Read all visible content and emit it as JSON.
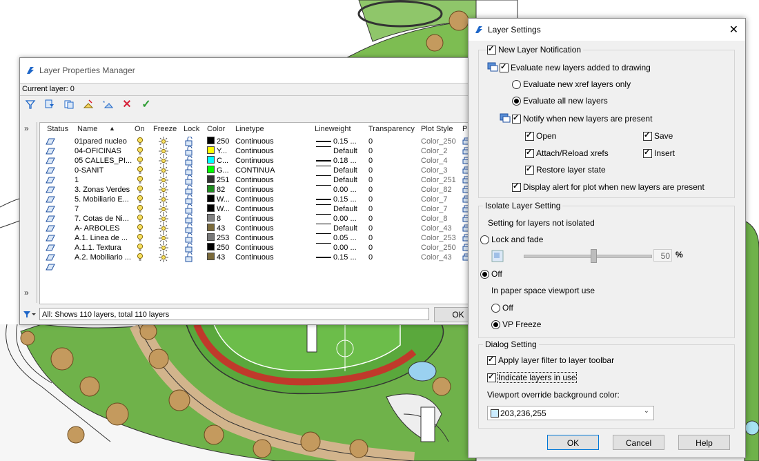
{
  "lpm": {
    "title": "Layer Properties Manager",
    "current_layer": "Current layer: 0",
    "columns": [
      "Status",
      "Name",
      "On",
      "Freeze",
      "Lock",
      "Color",
      "Linetype",
      "Lineweight",
      "Transparency",
      "Plot Style",
      "Pl"
    ],
    "rows": [
      {
        "name": "01pared nucleo",
        "color": "#000000",
        "color_label": "250",
        "linetype": "Continuous",
        "lw": "0.15 ...",
        "transp": "0",
        "plot": "Color_250",
        "thick": true
      },
      {
        "name": "04-OFICINAS",
        "color": "#ffff00",
        "color_label": "Y...",
        "linetype": "Continuous",
        "lw": "Default",
        "transp": "0",
        "plot": "Color_2",
        "thick": false
      },
      {
        "name": "05 CALLES_PI...",
        "color": "#00ffff",
        "color_label": "C...",
        "linetype": "Continuous",
        "lw": "0.18 ...",
        "transp": "0",
        "plot": "Color_4",
        "thick": true
      },
      {
        "name": "0-SANIT",
        "color": "#00ff00",
        "color_label": "G...",
        "linetype": "CONTINUA",
        "lw": "Default",
        "transp": "0",
        "plot": "Color_3",
        "thick": false
      },
      {
        "name": "1",
        "color": "#333333",
        "color_label": "251",
        "linetype": "Continuous",
        "lw": "Default",
        "transp": "0",
        "plot": "Color_251",
        "thick": false
      },
      {
        "name": "3. Zonas Verdes",
        "color": "#1e8c1e",
        "color_label": "82",
        "linetype": "Continuous",
        "lw": "0.00 ...",
        "transp": "0",
        "plot": "Color_82",
        "thick": false
      },
      {
        "name": "5. Mobiliario E...",
        "color": "#000000",
        "color_label": "W...",
        "linetype": "Continuous",
        "lw": "0.15 ...",
        "transp": "0",
        "plot": "Color_7",
        "thick": true
      },
      {
        "name": "7",
        "color": "#000000",
        "color_label": "W...",
        "linetype": "Continuous",
        "lw": "Default",
        "transp": "0",
        "plot": "Color_7",
        "thick": false
      },
      {
        "name": "7. Cotas de Ni...",
        "color": "#808080",
        "color_label": "8",
        "linetype": "Continuous",
        "lw": "0.00 ...",
        "transp": "0",
        "plot": "Color_8",
        "thick": false
      },
      {
        "name": "A- ARBOLES",
        "color": "#7a6a3a",
        "color_label": "43",
        "linetype": "Continuous",
        "lw": "Default",
        "transp": "0",
        "plot": "Color_43",
        "thick": false
      },
      {
        "name": "A.1. Linea de ...",
        "color": "#777777",
        "color_label": "253",
        "linetype": "Continuous",
        "lw": "0.05 ...",
        "transp": "0",
        "plot": "Color_253",
        "thick": false
      },
      {
        "name": "A.1.1. Textura",
        "color": "#000000",
        "color_label": "250",
        "linetype": "Continuous",
        "lw": "0.00 ...",
        "transp": "0",
        "plot": "Color_250",
        "thick": false
      },
      {
        "name": "A.2. Mobiliario ...",
        "color": "#7a6a3a",
        "color_label": "43",
        "linetype": "Continuous",
        "lw": "0.15 ...",
        "transp": "0",
        "plot": "Color_43",
        "thick": true
      }
    ],
    "status_text": "All: Shows 110 layers, total 110 layers",
    "ok_label": "OK"
  },
  "ls": {
    "title": "Layer Settings",
    "close_label": "✕",
    "new_layer_notification": "New Layer Notification",
    "evaluate_new_layers": "Evaluate new layers added to drawing",
    "evaluate_xref_only": "Evaluate new xref layers only",
    "evaluate_all": "Evaluate all new layers",
    "notify_when_present": "Notify when new layers are present",
    "open": "Open",
    "save": "Save",
    "attach_reload": "Attach/Reload xrefs",
    "insert": "Insert",
    "restore_state": "Restore layer state",
    "display_alert_plot": "Display alert for plot when new layers are present",
    "isolate_title": "Isolate Layer Setting",
    "setting_not_isolated": "Setting for layers not isolated",
    "lock_and_fade": "Lock and fade",
    "fade_value": "50",
    "percent": "%",
    "off": "Off",
    "paper_space_label": "In paper space viewport use",
    "ps_off": "Off",
    "vp_freeze": "VP Freeze",
    "dialog_title": "Dialog Setting",
    "apply_filter": "Apply layer filter to layer toolbar",
    "indicate_in_use": "Indicate layers in use",
    "viewport_bg_label": "Viewport override background color:",
    "viewport_bg_value": "203,236,255",
    "viewport_bg_color": "#cbecff",
    "ok": "OK",
    "cancel": "Cancel",
    "help": "Help"
  },
  "colors": {
    "accent": "#0078d7",
    "grass": "#6ab04c",
    "track": "#c0392b"
  }
}
